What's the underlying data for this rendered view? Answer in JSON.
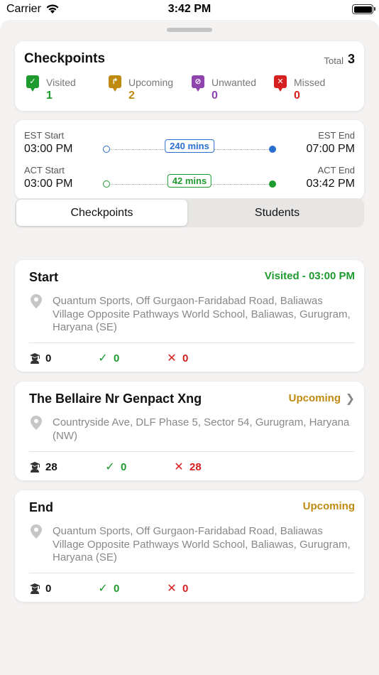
{
  "status_bar": {
    "carrier": "Carrier",
    "time": "3:42 PM"
  },
  "summary": {
    "title": "Checkpoints",
    "total_label": "Total",
    "total_value": "3",
    "stats": [
      {
        "label": "Visited",
        "value": "1",
        "color": "#1e9a2e"
      },
      {
        "label": "Upcoming",
        "value": "2",
        "color": "#c08a0f"
      },
      {
        "label": "Unwanted",
        "value": "0",
        "color": "#8e44ad"
      },
      {
        "label": "Missed",
        "value": "0",
        "color": "#d61f1f"
      }
    ]
  },
  "times": {
    "est": {
      "start_label": "EST Start",
      "start_value": "03:00 PM",
      "duration": "240 mins",
      "end_label": "EST End",
      "end_value": "07:00 PM",
      "color": "#2a6fcf"
    },
    "act": {
      "start_label": "ACT Start",
      "start_value": "03:00 PM",
      "duration": "42 mins",
      "end_label": "ACT End",
      "end_value": "03:42 PM",
      "color": "#1e9a2e"
    }
  },
  "tabs": [
    {
      "label": "Checkpoints"
    },
    {
      "label": "Students"
    }
  ],
  "checkpoints": [
    {
      "title": "Start",
      "status": "Visited - 03:00 PM",
      "status_color": "#1e9a2e",
      "address": "Quantum Sports, Off Gurgaon-Faridabad Road, Baliawas Village Opposite Pathways World School, Baliawas, Gurugram, Haryana (SE)",
      "students": "0",
      "present": "0",
      "absent": "0"
    },
    {
      "title": "The Bellaire Nr Genpact Xng",
      "status": "Upcoming",
      "status_color": "#c08a0f",
      "address": "Countryside Ave, DLF Phase 5, Sector 54, Gurugram, Haryana (NW)",
      "students": "28",
      "present": "0",
      "absent": "28"
    },
    {
      "title": "End",
      "status": "Upcoming",
      "status_color": "#c08a0f",
      "address": "Quantum Sports, Off Gurgaon-Faridabad Road, Baliawas Village Opposite Pathways World School, Baliawas, Gurugram, Haryana (SE)",
      "students": "0",
      "present": "0",
      "absent": "0"
    }
  ]
}
